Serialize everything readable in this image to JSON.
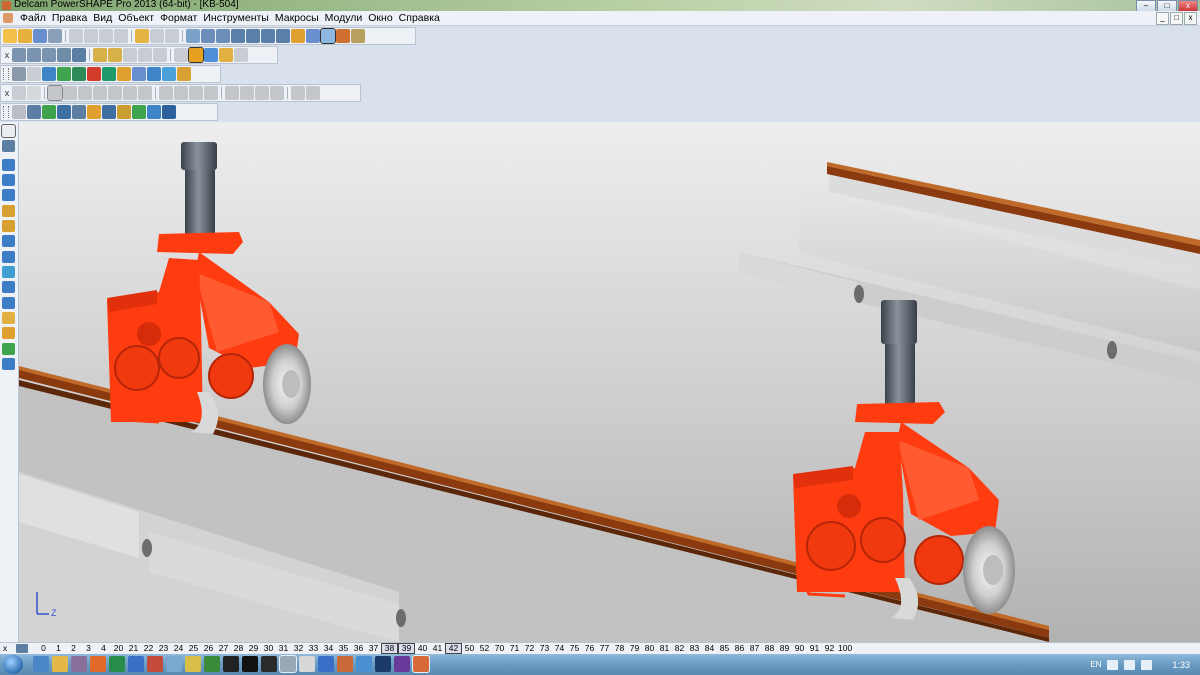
{
  "window": {
    "title": "Delcam PowerSHAPE Pro 2013 (64-bit) - [KB-504]",
    "buttons": {
      "minimize": "–",
      "maximize": "□",
      "close": "x"
    }
  },
  "menu": {
    "items": [
      "Файл",
      "Правка",
      "Вид",
      "Объект",
      "Формат",
      "Инструменты",
      "Макросы",
      "Модули",
      "Окно",
      "Справка"
    ],
    "mdi_buttons": {
      "minimize": "_",
      "restore": "□",
      "close": "x"
    }
  },
  "levels": {
    "numbers": [
      "0",
      "1",
      "2",
      "3",
      "4",
      "20",
      "21",
      "22",
      "23",
      "24",
      "25",
      "26",
      "27",
      "28",
      "29",
      "30",
      "31",
      "32",
      "33",
      "34",
      "35",
      "36",
      "37",
      "38",
      "39",
      "40",
      "41",
      "42",
      "50",
      "52",
      "70",
      "71",
      "72",
      "73",
      "74",
      "75",
      "76",
      "77",
      "78",
      "79",
      "80",
      "81",
      "82",
      "83",
      "84",
      "85",
      "86",
      "87",
      "88",
      "89",
      "90",
      "91",
      "92",
      "100"
    ],
    "active": [
      "38",
      "39",
      "42"
    ]
  },
  "taskbar": {
    "language": "EN",
    "clock": "1:33"
  },
  "axis": {
    "z_label": "Z"
  },
  "colors": {
    "carriage_red": "#ff3b10",
    "rail_brown": "#8a3a0e",
    "beam_gray": "#d6d6d6",
    "post_gray": "#555b66"
  }
}
